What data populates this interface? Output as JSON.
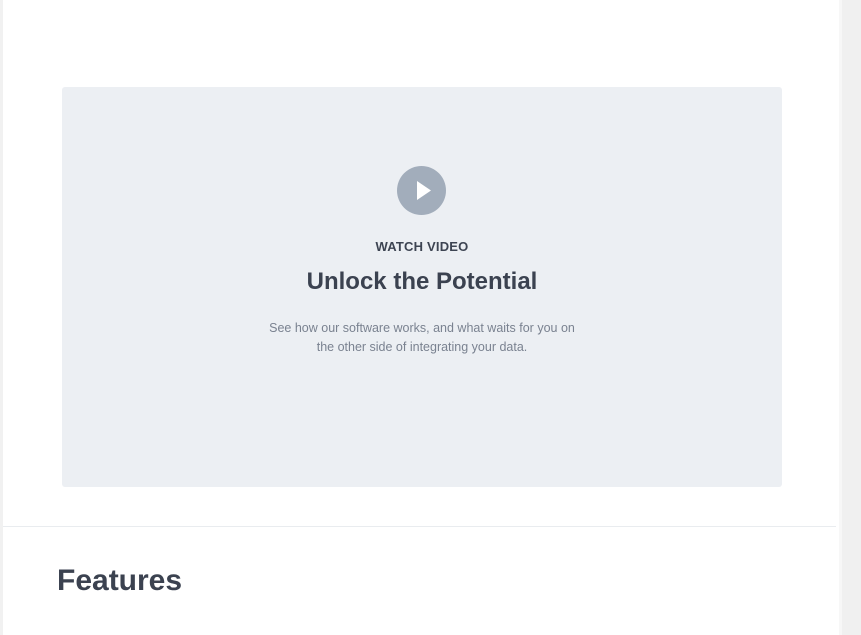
{
  "video": {
    "eyebrow": "WATCH VIDEO",
    "title": "Unlock the Potential",
    "description": "See how our software works, and what waits for you on the other side of integrating your data.",
    "play_icon": "play-icon"
  },
  "features": {
    "title": "Features"
  },
  "colors": {
    "card_bg": "#eceff3",
    "play_circle": "#a2adbb",
    "heading": "#3b4250",
    "muted_text": "#7a8290"
  }
}
